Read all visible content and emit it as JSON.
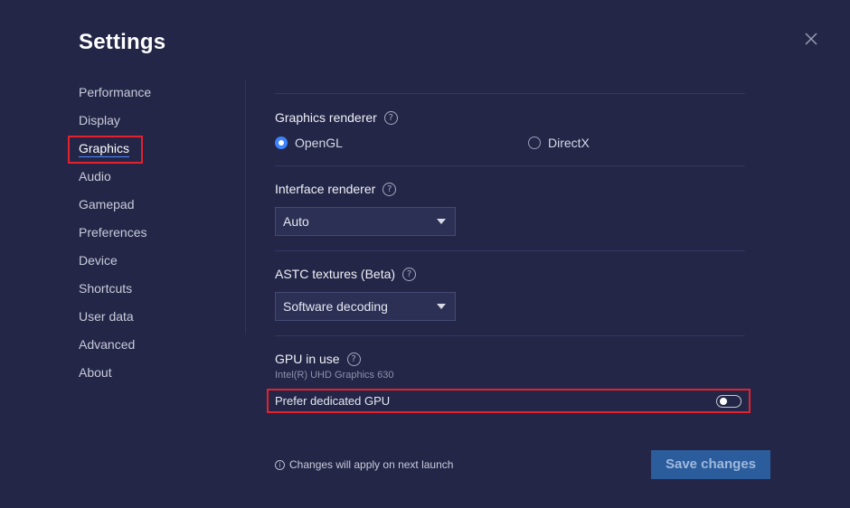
{
  "window": {
    "title": "Settings"
  },
  "sidebar": {
    "items": [
      {
        "label": "Performance"
      },
      {
        "label": "Display"
      },
      {
        "label": "Graphics"
      },
      {
        "label": "Audio"
      },
      {
        "label": "Gamepad"
      },
      {
        "label": "Preferences"
      },
      {
        "label": "Device"
      },
      {
        "label": "Shortcuts"
      },
      {
        "label": "User data"
      },
      {
        "label": "Advanced"
      },
      {
        "label": "About"
      }
    ],
    "active": "Graphics"
  },
  "graphics_renderer": {
    "label": "Graphics renderer",
    "options": [
      {
        "label": "OpenGL",
        "checked": true
      },
      {
        "label": "DirectX",
        "checked": false
      }
    ]
  },
  "interface_renderer": {
    "label": "Interface renderer",
    "selected": "Auto"
  },
  "astc_textures": {
    "label": "ASTC textures (Beta)",
    "selected": "Software decoding"
  },
  "gpu": {
    "label": "GPU in use",
    "name": "Intel(R) UHD Graphics 630",
    "prefer_label": "Prefer dedicated GPU",
    "prefer_enabled": false
  },
  "footer": {
    "note": "Changes will apply on next launch",
    "info_icon": "i",
    "save_label": "Save changes"
  },
  "icons": {
    "help": "?",
    "close": "close-icon"
  },
  "colors": {
    "background": "#232647",
    "accent": "#3d83ff",
    "highlight": "#e3222d",
    "save_button": "#2b5c9c"
  }
}
